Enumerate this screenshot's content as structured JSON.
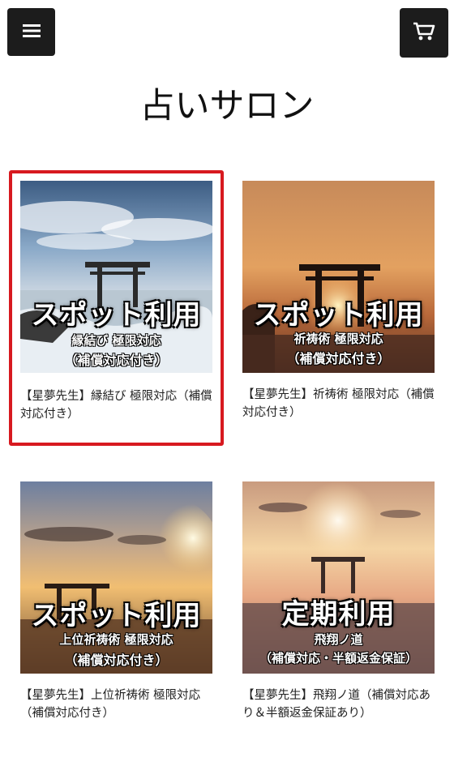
{
  "header": {
    "menu_icon": "hamburger-menu-icon",
    "cart_icon": "shopping-cart-icon",
    "title": "占いサロン"
  },
  "accent_color": "#d7191f",
  "products": [
    {
      "image_title": "スポット利用",
      "image_line1": "縁結び 極限対応",
      "image_line2": "（補償対応付き）",
      "name": "【星夢先生】縁結び 極限対応（補償対応付き）",
      "selected": true
    },
    {
      "image_title": "スポット利用",
      "image_line1": "祈祷術 極限対応",
      "image_line2": "（補償対応付き）",
      "name": "【星夢先生】祈祷術 極限対応（補償対応付き）",
      "selected": false
    },
    {
      "image_title": "スポット利用",
      "image_line1": "上位祈祷術 極限対応",
      "image_line2": "（補償対応付き）",
      "name": "【星夢先生】上位祈祷術 極限対応（補償対応付き）",
      "selected": false
    },
    {
      "image_title": "定期利用",
      "image_line1": "飛翔ノ道",
      "image_line2": "（補償対応・半額返金保証）",
      "name": "【星夢先生】飛翔ノ道（補償対応あり＆半額返金保証あり）",
      "selected": false
    }
  ]
}
